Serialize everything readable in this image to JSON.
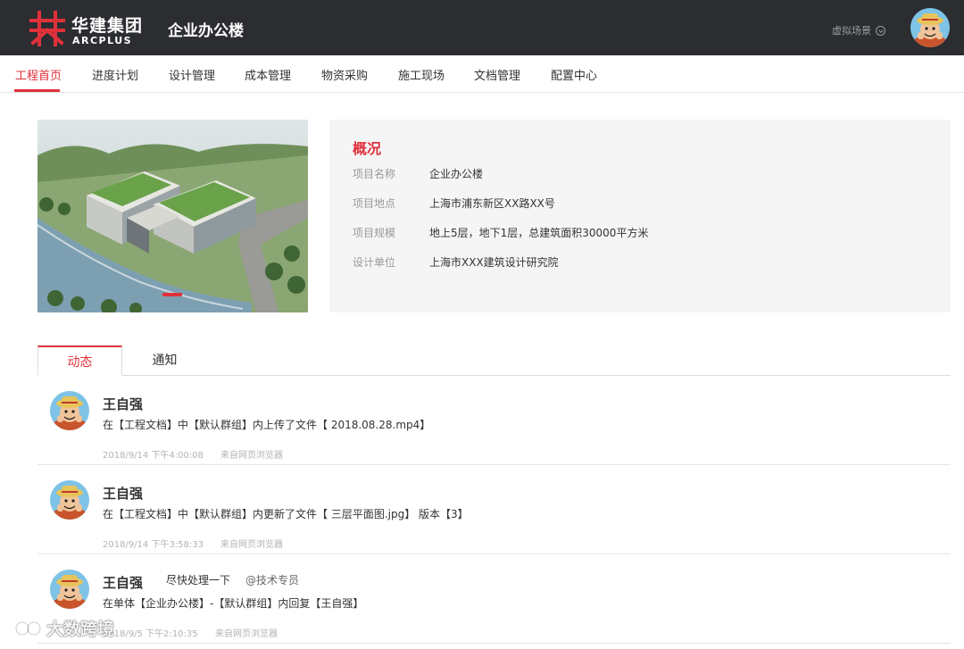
{
  "header": {
    "brand_cn": "华建集团",
    "brand_en": "ARCPLUS",
    "project_title": "企业办公楼",
    "scene_label": "虚拟场景",
    "brand_color": "#e0313a",
    "bar_color": "#2b2d31"
  },
  "nav": {
    "items": [
      {
        "label": "工程首页",
        "active": true
      },
      {
        "label": "进度计划"
      },
      {
        "label": "设计管理"
      },
      {
        "label": "成本管理"
      },
      {
        "label": "物资采购"
      },
      {
        "label": "施工现场"
      },
      {
        "label": "文档管理"
      },
      {
        "label": "配置中心"
      }
    ]
  },
  "overview": {
    "title": "概况",
    "rows": [
      {
        "label": "项目名称",
        "value": "企业办公楼"
      },
      {
        "label": "项目地点",
        "value": "上海市浦东新区XX路XX号"
      },
      {
        "label": "项目规模",
        "value": "地上5层，地下1层，总建筑面积30000平方米"
      },
      {
        "label": "设计单位",
        "value": "上海市XXX建筑设计研究院"
      }
    ]
  },
  "tabs": [
    {
      "label": "动态",
      "active": true
    },
    {
      "label": "通知"
    }
  ],
  "feed": [
    {
      "name": "王自强",
      "text": "在【工程文档】中【默认群组】内上传了文件【 2018.08.28.mp4】",
      "time": "2018/9/14 下午4:00:08",
      "source": "来自网页浏览器"
    },
    {
      "name": "王自强",
      "text": "在【工程文档】中【默认群组】内更新了文件【 三层平面图.jpg】 版本【3】",
      "time": "2018/9/14 下午3:58:33",
      "source": "来自网页浏览器"
    },
    {
      "name": "王自强",
      "text": "在单体【企业办公楼】-【默认群组】内回复【王自强】",
      "reply": "尽快处理一下",
      "mention": "@技术专员",
      "time": "2018/9/5 下午2:10:35",
      "source": "来自网页浏览器"
    }
  ],
  "watermark": "大数跨境"
}
